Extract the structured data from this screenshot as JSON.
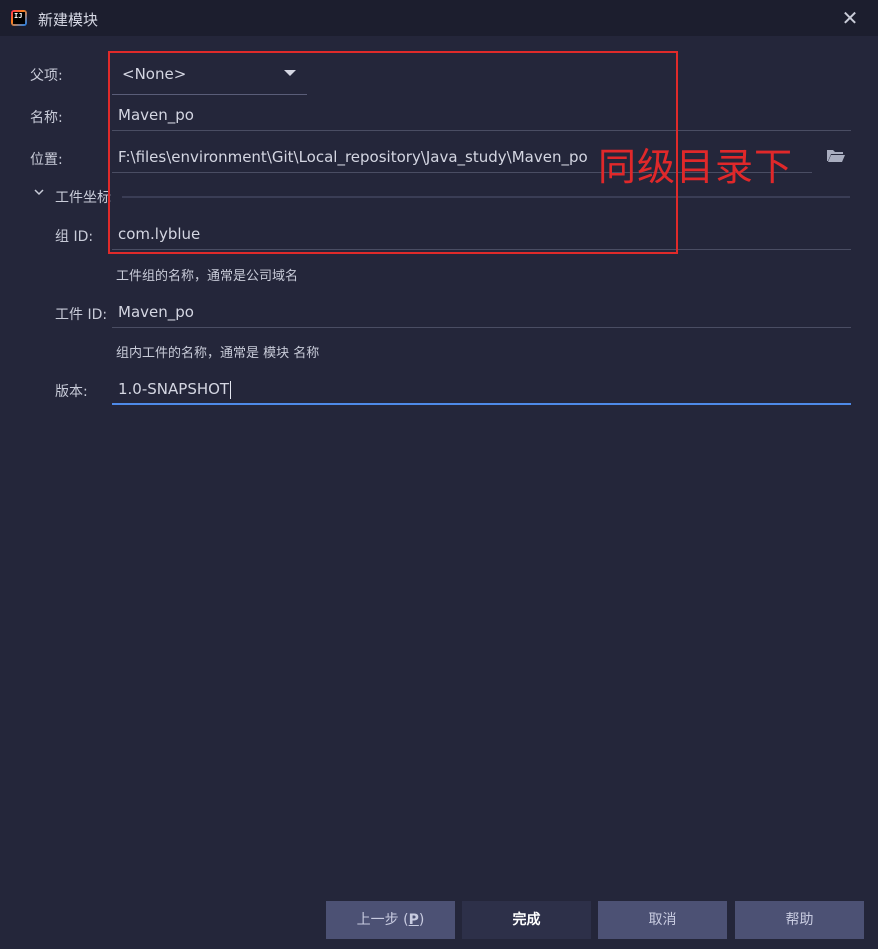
{
  "window": {
    "title": "新建模块"
  },
  "form": {
    "parent": {
      "label": "父项:",
      "value": "<None>"
    },
    "name": {
      "label": "名称:",
      "value": "Maven_po"
    },
    "location": {
      "label": "位置:",
      "value": "F:\\files\\environment\\Git\\Local_repository\\Java_study\\Maven_po"
    },
    "section": {
      "title": "工件坐标",
      "expanded": true
    },
    "group_id": {
      "label": "组 ID:",
      "value": "com.lyblue",
      "hint": "工件组的名称，通常是公司域名"
    },
    "artifact_id": {
      "label": "工件 ID:",
      "value": "Maven_po",
      "hint": "组内工件的名称，通常是 模块 名称"
    },
    "version": {
      "label": "版本:",
      "value": "1.0-SNAPSHOT"
    }
  },
  "annotation": {
    "text": "同级目录下",
    "color": "#e0282a"
  },
  "buttons": {
    "previous": {
      "label": "上一步 (",
      "mnemonic": "P",
      "suffix": ")"
    },
    "finish": "完成",
    "cancel": "取消",
    "help": "帮助"
  },
  "icons": {
    "app": "intellij-idea-icon",
    "close": "close-icon",
    "combo_arrow": "triangle-down-icon",
    "folder": "folder-open-icon",
    "section": "chevron-down-icon"
  },
  "colors": {
    "background": "#24263a",
    "titlebar": "#1c1e2e",
    "focus_underline": "#4e8ae8",
    "button_secondary": "#4c5174",
    "button_primary": "#2d3049",
    "annotation": "#e02a2a"
  }
}
